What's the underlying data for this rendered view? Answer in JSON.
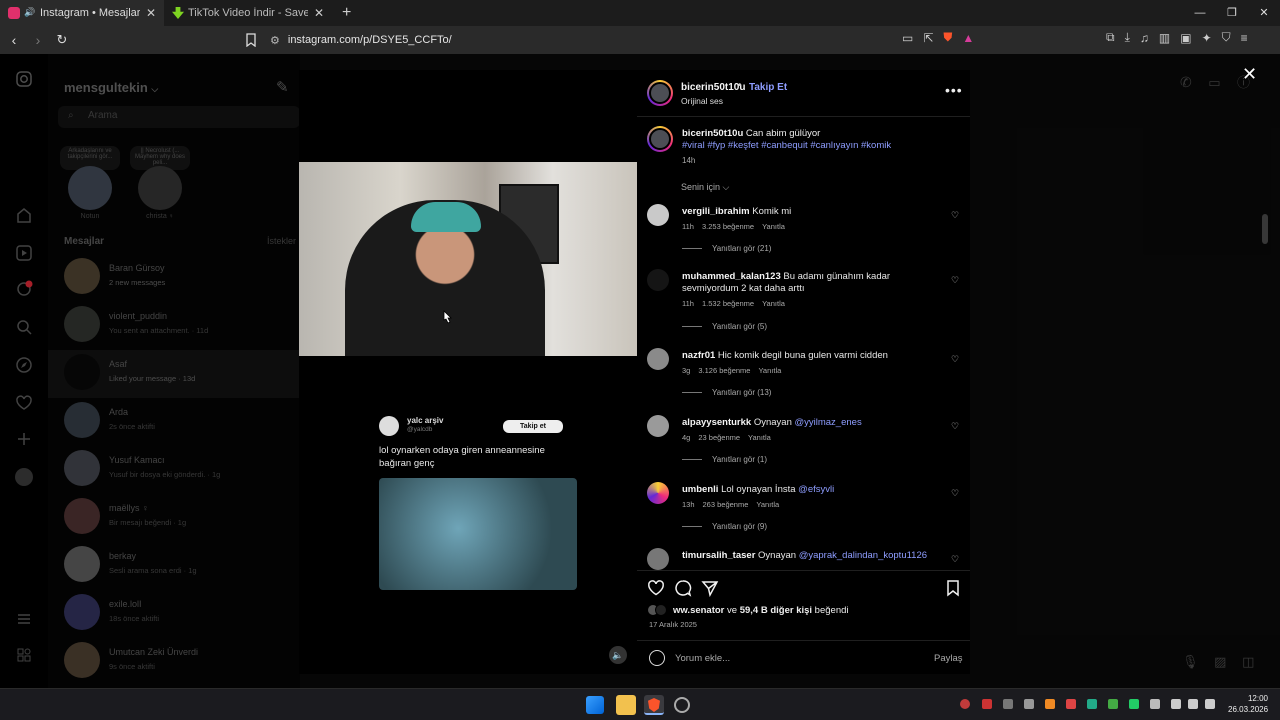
{
  "tabs": [
    {
      "title": "Instagram • Mesajlar",
      "active": true,
      "favicon_color": "#e1306c"
    },
    {
      "title": "TikTok Video İndir - SaveFrom ile Ücr",
      "active": false,
      "favicon_color": "#7ed321"
    }
  ],
  "address_bar": {
    "url": "instagram.com/p/DSYE5_CCFTo/"
  },
  "dm_panel": {
    "username": "mensgultekin",
    "search_placeholder": "Arama",
    "notes": [
      {
        "bubble": "Arkadaşlarını ve takipçilerini gör...",
        "label": "Notun"
      },
      {
        "bubble": "|| Necrolust (... Mayhem why does peli...",
        "label": "christa ♀"
      }
    ],
    "messages_header": "Mesajlar",
    "requests_label": "İstekler",
    "conversations": [
      {
        "name": "Baran Gürsoy",
        "sub": "2 new messages"
      },
      {
        "name": "violent_puddin",
        "sub": "You sent an attachment. · 11d"
      },
      {
        "name": "Asaf",
        "sub": "Liked your message · 13d"
      },
      {
        "name": "Arda",
        "sub": "2s önce aktifti"
      },
      {
        "name": "Yusuf Kamacı",
        "sub": "Yusuf bir dosya eki gönderdi. · 1g"
      },
      {
        "name": "maëllys ♀",
        "sub": "Bir mesajı beğendi · 1g"
      },
      {
        "name": "berkay",
        "sub": "Sesli arama sona erdi · 1g"
      },
      {
        "name": "exile.lolI",
        "sub": "18s önce aktifti"
      },
      {
        "name": "Umutcan Zeki Ünverdi",
        "sub": "9s önce aktifti"
      }
    ]
  },
  "video": {
    "tweet": {
      "name": "yalc arşiv",
      "handle": "@yalcdb",
      "follow_label": "Takip et",
      "text": "lol oynarken odaya giren anneannesine bağıran genç"
    }
  },
  "post_panel": {
    "header": {
      "username": "bicerin50t10u",
      "dot": "•",
      "follow_label": "Takip Et",
      "audio": "Orijinal ses"
    },
    "caption": {
      "username": "bicerin50t10u",
      "text": "Can abim gülüyor",
      "tags": "#viral #fyp #keşfet #canbequit #canlıyayın #komik",
      "time": "14h"
    },
    "for_you_label": "Senin için ⌵",
    "comments": [
      {
        "username": "vergili_ibrahim",
        "text": "Komik mi",
        "time": "11h",
        "likes": "3.253 beğenme",
        "reply": "Yanıtla",
        "replies": "Yanıtları gör (21)"
      },
      {
        "username": "muhammed_kalan123",
        "text": "Bu adamı günahım kadar sevmiyordum 2 kat daha arttı",
        "time": "11h",
        "likes": "1.532 beğenme",
        "reply": "Yanıtla",
        "replies": "Yanıtları gör (5)"
      },
      {
        "username": "nazfr01",
        "text": "Hic komik degil buna gulen varmi cidden",
        "time": "3g",
        "likes": "3.126 beğenme",
        "reply": "Yanıtla",
        "replies": "Yanıtları gör (13)"
      },
      {
        "username": "alpayysenturkk",
        "text": "Oynayan ",
        "mention": "@yyilmaz_enes",
        "time": "4g",
        "likes": "23 beğenme",
        "reply": "Yanıtla",
        "replies": "Yanıtları gör (1)"
      },
      {
        "username": "umbenli",
        "text": "Lol oynayan İnsta ",
        "mention": "@efsyvli",
        "time": "13h",
        "likes": "263 beğenme",
        "reply": "Yanıtla",
        "replies": "Yanıtları gör (9)"
      },
      {
        "username": "timursalih_taser",
        "text": "Oynayan ",
        "mention": "@yaprak_dalindan_koptu1126"
      }
    ],
    "likes_line": {
      "user": "ww.senator",
      "rest": " ve ",
      "count": "59,4 B diğer kişi",
      "suffix": " beğendi"
    },
    "date": "17 Aralık 2025",
    "comment_placeholder": "Yorum ekle...",
    "post_label": "Paylaş"
  },
  "taskbar": {
    "time": "12:00",
    "date": "26.03.2026"
  },
  "colors": {
    "accent_link": "#8e9dff",
    "instagram_gradient": "#ee2a7b"
  }
}
